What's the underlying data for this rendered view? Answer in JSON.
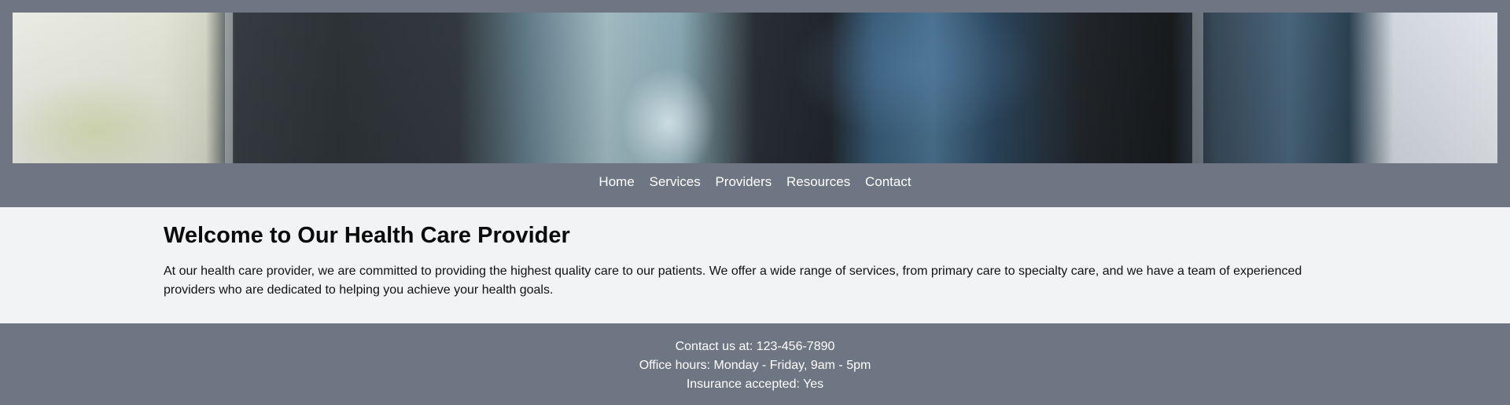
{
  "header": {
    "banner_alt": "health care banner image",
    "nav": {
      "items": [
        {
          "label": "Home"
        },
        {
          "label": "Services"
        },
        {
          "label": "Providers"
        },
        {
          "label": "Resources"
        },
        {
          "label": "Contact"
        }
      ]
    }
  },
  "main": {
    "title": "Welcome to Our Health Care Provider",
    "paragraph": "At our health care provider, we are committed to providing the highest quality care to our patients. We offer a wide range of services, from primary care to specialty care, and we have a team of experienced providers who are dedicated to helping you achieve your health goals."
  },
  "footer": {
    "contact": "Contact us at: 123-456-7890",
    "hours": "Office hours: Monday - Friday, 9am - 5pm",
    "insurance": "Insurance accepted: Yes"
  },
  "colors": {
    "header_bg": "#6e7583",
    "body_bg": "#f2f3f5",
    "footer_bg": "#6e7583"
  }
}
